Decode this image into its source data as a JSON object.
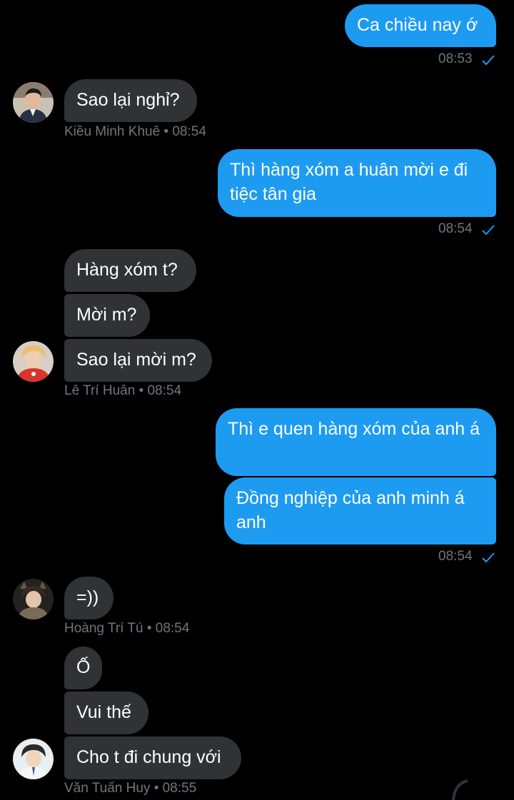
{
  "colors": {
    "background": "#000000",
    "incoming_bubble": "#2f3336",
    "outgoing_bubble": "#1d9bf0",
    "meta_text": "#71767b",
    "read_check": "#1d9bf0"
  },
  "messages": [
    {
      "dir": "out",
      "text": "Ca chiều nay ớ"
    },
    {
      "dir": "out_time",
      "text": "08:53"
    },
    {
      "dir": "in",
      "text": "Sao lại nghỉ?"
    },
    {
      "dir": "in_meta",
      "text": "Kiều Minh Khuê • 08:54"
    },
    {
      "dir": "out",
      "text": "Thì hàng xóm a huân mời e đi tiệc tân gia"
    },
    {
      "dir": "out_time",
      "text": "08:54"
    },
    {
      "dir": "in",
      "text": "Hàng xóm t?"
    },
    {
      "dir": "in",
      "text": "Mời m?"
    },
    {
      "dir": "in",
      "text": "Sao lại mời m?"
    },
    {
      "dir": "in_meta",
      "text": "Lê Trí Huân • 08:54"
    },
    {
      "dir": "out",
      "text": "Thì e quen hàng xóm của anh á"
    },
    {
      "dir": "out",
      "text": "Đồng nghiệp của anh minh á anh"
    },
    {
      "dir": "out_time",
      "text": "08:54"
    },
    {
      "dir": "in",
      "text": "=))"
    },
    {
      "dir": "in_meta",
      "text": "Hoàng Trí Tú • 08:54"
    },
    {
      "dir": "in",
      "text": "Ố"
    },
    {
      "dir": "in",
      "text": "Vui thế"
    },
    {
      "dir": "in",
      "text": "Cho t đi chung với"
    },
    {
      "dir": "in_meta",
      "text": "Văn Tuấn Huy • 08:55"
    }
  ],
  "avatars": [
    {
      "icon": "user-avatar-icon",
      "sender": "Kiều Minh Khuê"
    },
    {
      "icon": "user-avatar-icon",
      "sender": "Lê Trí Huân"
    },
    {
      "icon": "user-avatar-icon",
      "sender": "Hoàng Trí Tú"
    },
    {
      "icon": "user-avatar-icon",
      "sender": "Văn Tuấn Huy"
    }
  ],
  "read_icon": "check-icon"
}
